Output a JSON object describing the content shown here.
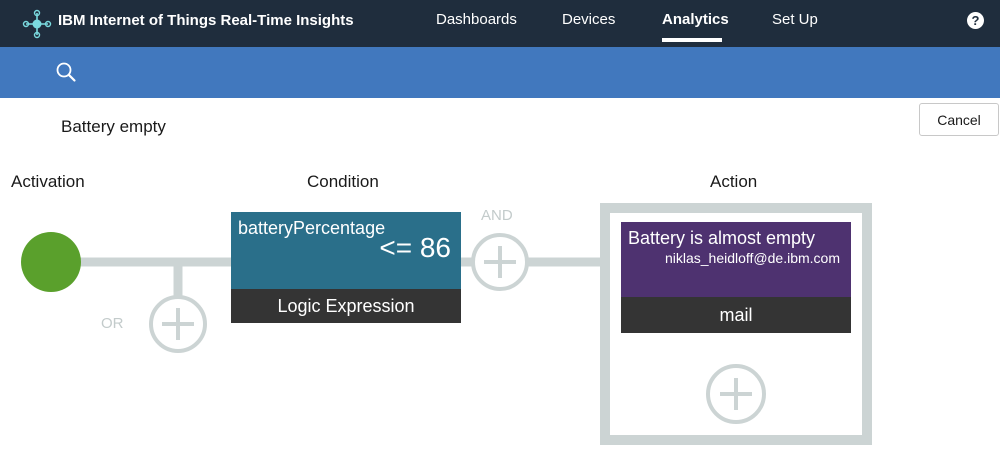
{
  "header": {
    "brand_prefix": "IBM",
    "brand_name": "Internet of Things Real-Time Insights",
    "nav": [
      "Dashboards",
      "Devices",
      "Analytics",
      "Set Up"
    ],
    "active_nav": "Analytics",
    "help_symbol": "?"
  },
  "search": {
    "icon": "search-icon"
  },
  "rule": {
    "name": "Battery empty",
    "cancel_label": "Cancel"
  },
  "columns": {
    "activation": "Activation",
    "condition": "Condition",
    "action": "Action"
  },
  "condition": {
    "field": "batteryPercentage",
    "expression": "<= 86",
    "type": "Logic Expression"
  },
  "action": {
    "title": "Battery is almost empty",
    "recipient": "niklas_heidloff@de.ibm.com",
    "type": "mail"
  },
  "connectors": {
    "and_label": "AND",
    "or_label": "OR"
  },
  "colors": {
    "header_bg": "#1f2d3d",
    "search_bg": "#4178be",
    "activation_circle": "#5aa02c",
    "condition_card": "#2a6f8a",
    "action_card": "#4e3270",
    "card_footer": "#343434",
    "connector": "#ccd4d4"
  }
}
